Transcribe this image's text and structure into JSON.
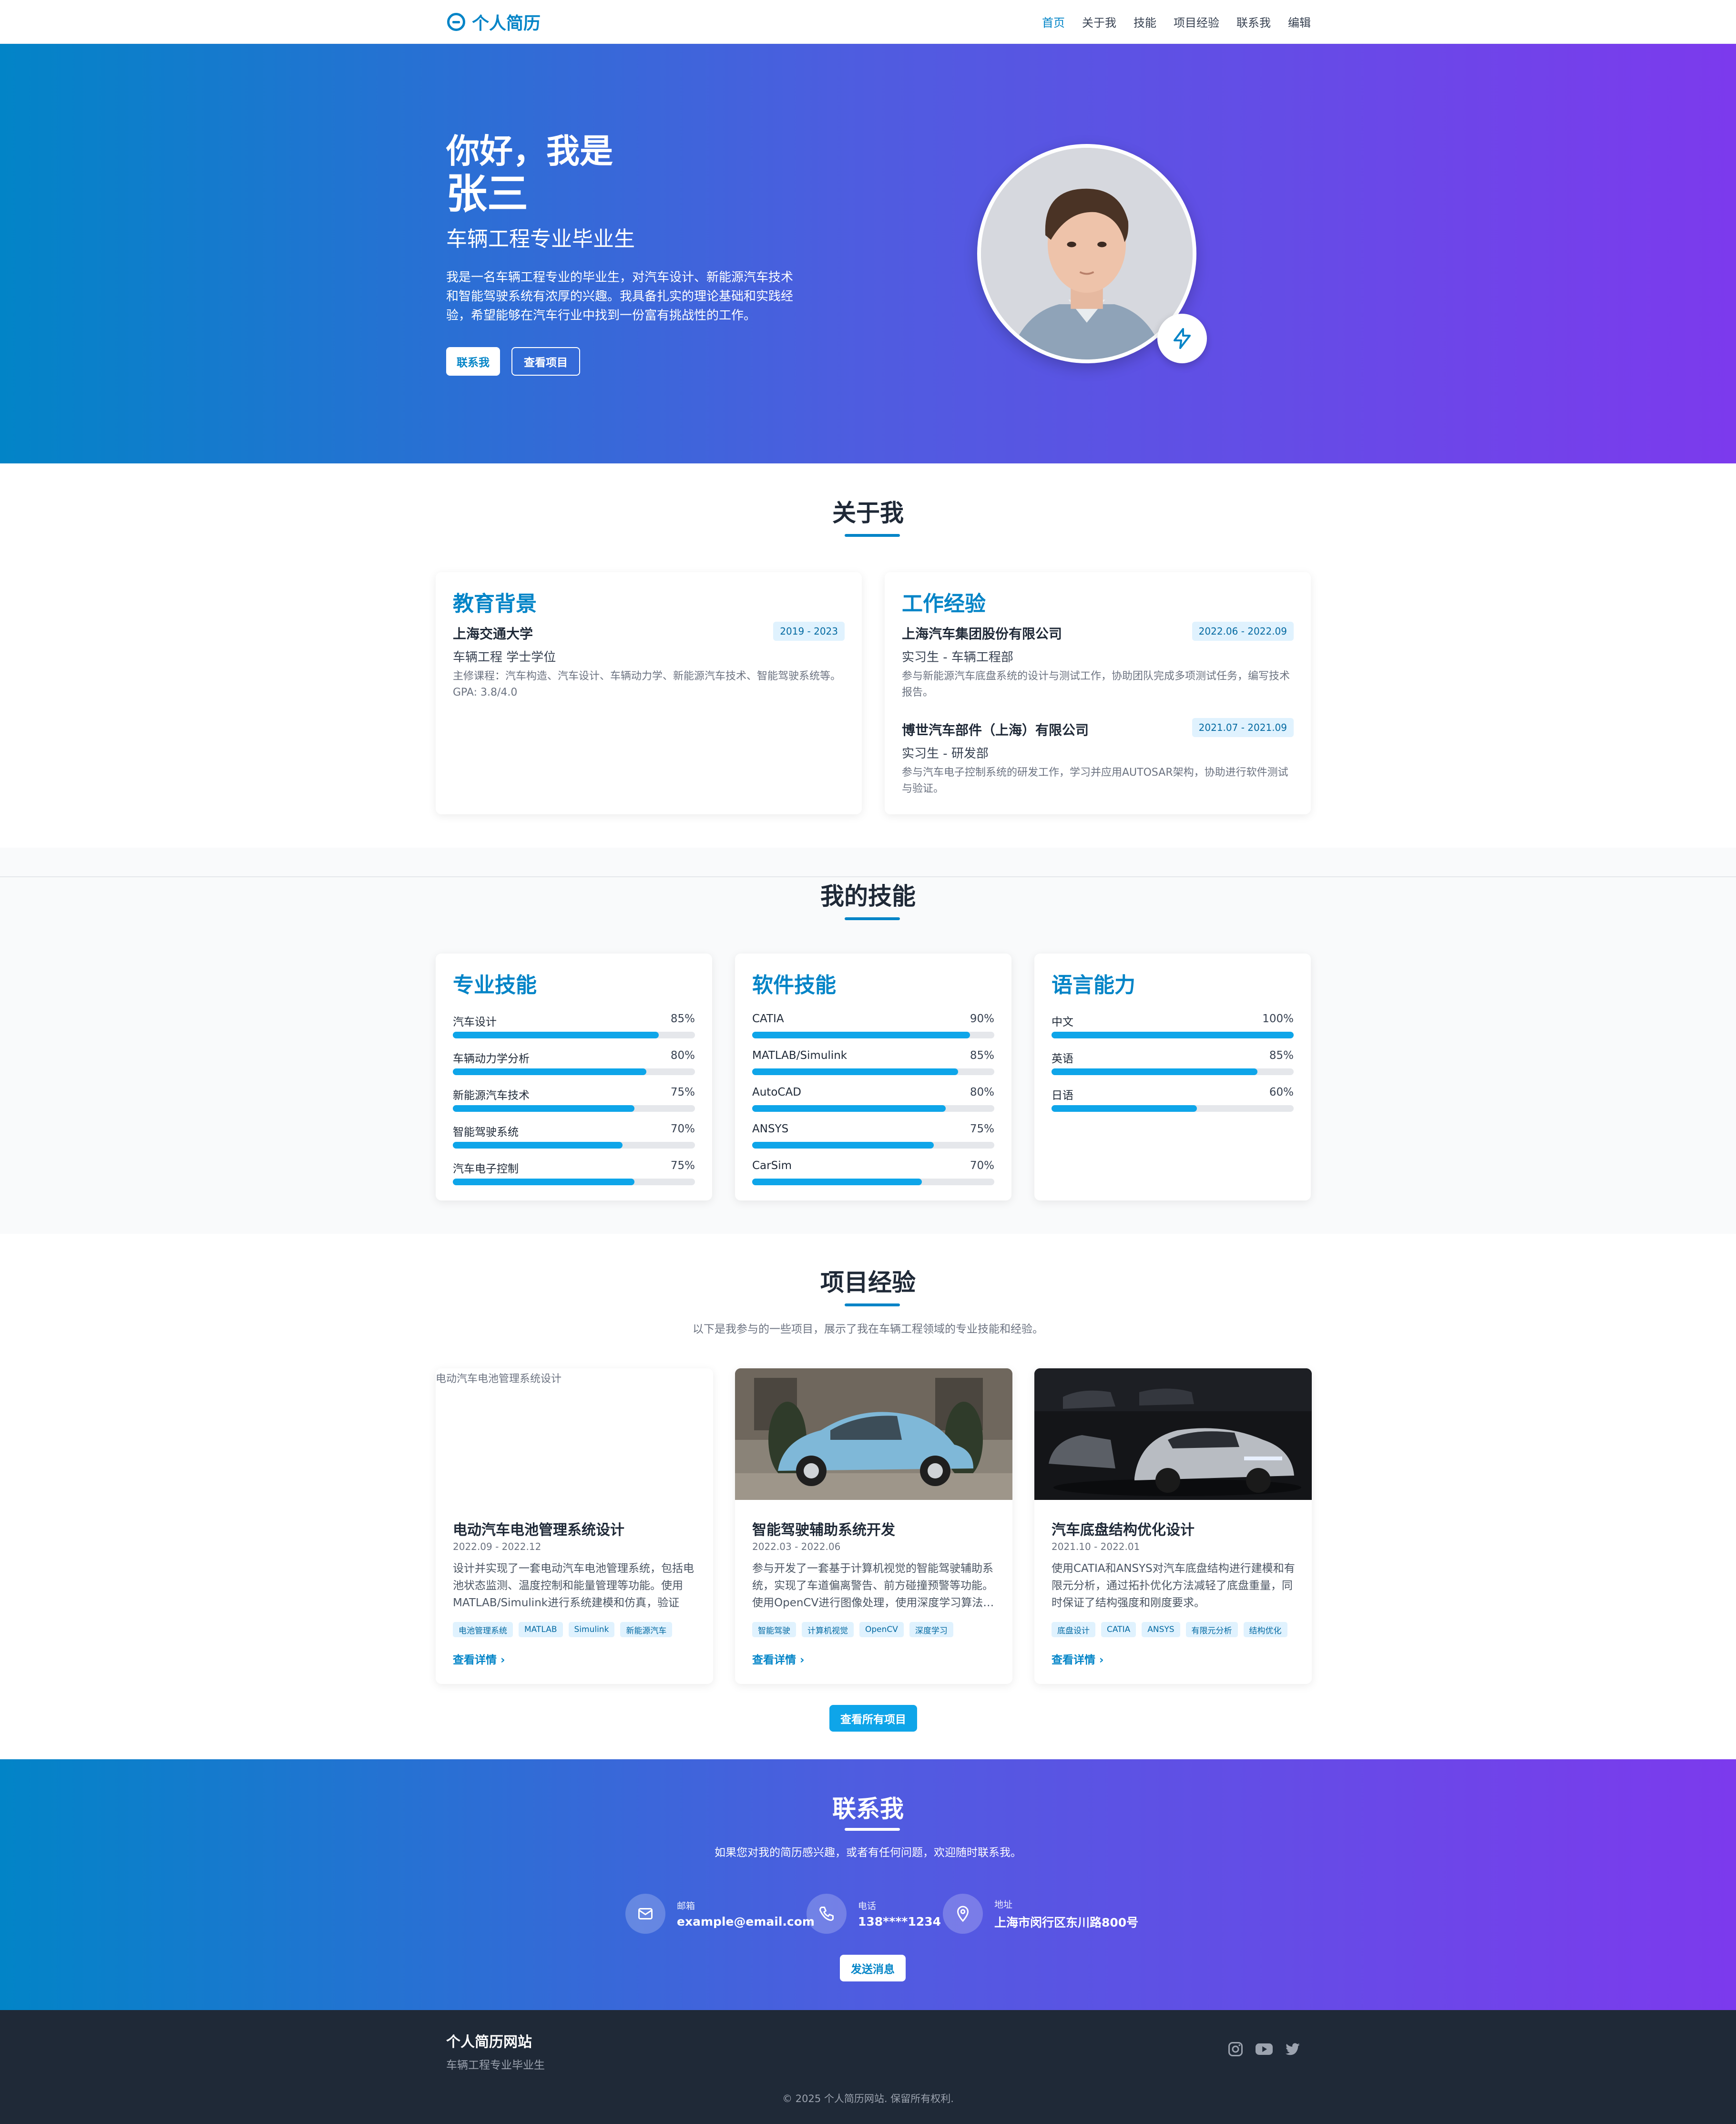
{
  "nav": {
    "brand": "个人简历",
    "links": [
      "首页",
      "关于我",
      "技能",
      "项目经验",
      "联系我",
      "编辑"
    ],
    "active_index": 0
  },
  "hero": {
    "greeting": "你好，我是",
    "name": "张三",
    "subtitle": "车辆工程专业毕业生",
    "description": "我是一名车辆工程专业的毕业生，对汽车设计、新能源汽车技术和智能驾驶系统有浓厚的兴趣。我具备扎实的理论基础和实践经验，希望能够在汽车行业中找到一份富有挑战性的工作。",
    "btn_contact": "联系我",
    "btn_projects": "查看项目"
  },
  "about": {
    "title": "关于我",
    "education": {
      "heading": "教育背景",
      "school": "上海交通大学",
      "date": "2019 - 2023",
      "degree": "车辆工程 学士学位",
      "desc": "主修课程：汽车构造、汽车设计、车辆动力学、新能源汽车技术、智能驾驶系统等。GPA: 3.8/4.0"
    },
    "work": {
      "heading": "工作经验",
      "jobs": [
        {
          "company": "上海汽车集团股份有限公司",
          "date": "2022.06 - 2022.09",
          "role": "实习生 - 车辆工程部",
          "desc": "参与新能源汽车底盘系统的设计与测试工作，协助团队完成多项测试任务，编写技术报告。"
        },
        {
          "company": "博世汽车部件（上海）有限公司",
          "date": "2021.07 - 2021.09",
          "role": "实习生 - 研发部",
          "desc": "参与汽车电子控制系统的研发工作，学习并应用AUTOSAR架构，协助进行软件测试与验证。"
        }
      ]
    }
  },
  "skills": {
    "title": "我的技能",
    "groups": [
      {
        "heading": "专业技能",
        "items": [
          {
            "name": "汽车设计",
            "pct": "85%",
            "value": 85
          },
          {
            "name": "车辆动力学分析",
            "pct": "80%",
            "value": 80
          },
          {
            "name": "新能源汽车技术",
            "pct": "75%",
            "value": 75
          },
          {
            "name": "智能驾驶系统",
            "pct": "70%",
            "value": 70
          },
          {
            "name": "汽车电子控制",
            "pct": "75%",
            "value": 75
          }
        ]
      },
      {
        "heading": "软件技能",
        "items": [
          {
            "name": "CATIA",
            "pct": "90%",
            "value": 90
          },
          {
            "name": "MATLAB/Simulink",
            "pct": "85%",
            "value": 85
          },
          {
            "name": "AutoCAD",
            "pct": "80%",
            "value": 80
          },
          {
            "name": "ANSYS",
            "pct": "75%",
            "value": 75
          },
          {
            "name": "CarSim",
            "pct": "70%",
            "value": 70
          }
        ]
      },
      {
        "heading": "语言能力",
        "items": [
          {
            "name": "中文",
            "pct": "100%",
            "value": 100
          },
          {
            "name": "英语",
            "pct": "85%",
            "value": 85
          },
          {
            "name": "日语",
            "pct": "60%",
            "value": 60
          }
        ]
      }
    ]
  },
  "projects": {
    "title": "项目经验",
    "intro": "以下是我参与的一些项目，展示了我在车辆工程领域的专业技能和经验。",
    "items": [
      {
        "img_alt": "电动汽车电池管理系统设计",
        "title": "电动汽车电池管理系统设计",
        "date": "2022.09 - 2022.12",
        "desc": "设计并实现了一套电动汽车电池管理系统，包括电池状态监测、温度控制和能量管理等功能。使用MATLAB/Simulink进行系统建模和仿真，验证了…",
        "tags": [
          "电池管理系统",
          "MATLAB",
          "Simulink",
          "新能源汽车"
        ],
        "link": "查看详情"
      },
      {
        "img_alt": "",
        "title": "智能驾驶辅助系统开发",
        "date": "2022.03 - 2022.06",
        "desc": "参与开发了一套基于计算机视觉的智能驾驶辅助系统，实现了车道偏离警告、前方碰撞预警等功能。使用OpenCV进行图像处理，使用深度学习算法…",
        "tags": [
          "智能驾驶",
          "计算机视觉",
          "OpenCV",
          "深度学习"
        ],
        "link": "查看详情"
      },
      {
        "img_alt": "",
        "title": "汽车底盘结构优化设计",
        "date": "2021.10 - 2022.01",
        "desc": "使用CATIA和ANSYS对汽车底盘结构进行建模和有限元分析，通过拓扑优化方法减轻了底盘重量，同时保证了结构强度和刚度要求。",
        "tags": [
          "底盘设计",
          "CATIA",
          "ANSYS",
          "有限元分析",
          "结构优化"
        ],
        "link": "查看详情"
      }
    ],
    "btn_all": "查看所有项目"
  },
  "contact": {
    "title": "联系我",
    "intro": "如果您对我的简历感兴趣，或者有任何问题，欢迎随时联系我。",
    "email_label": "邮箱",
    "email": "example@email.com",
    "phone_label": "电话",
    "phone": "138****1234",
    "address_label": "地址",
    "address": "上海市闵行区东川路800号",
    "btn_send": "发送消息"
  },
  "footer": {
    "title": "个人简历网站",
    "subtitle": "车辆工程专业毕业生",
    "copyright": "© 2025 个人简历网站. 保留所有权利."
  },
  "colors": {
    "primary": "#0284c7",
    "gradient_start": "#0284c7",
    "gradient_end": "#7c3aed",
    "skill_bar": "#0ea5e9",
    "footer_bg": "#1f2937"
  }
}
